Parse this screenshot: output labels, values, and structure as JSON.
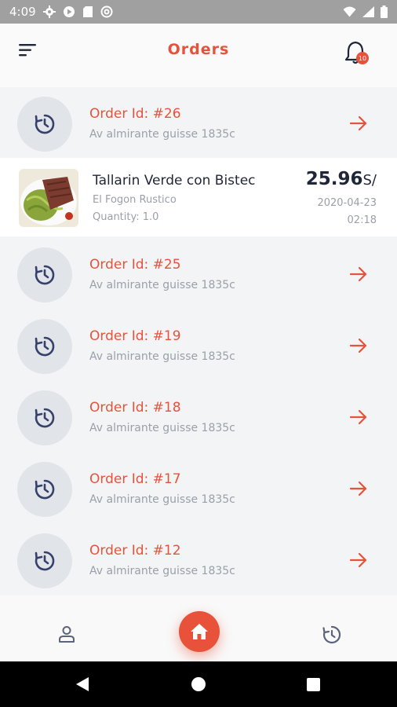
{
  "status_bar": {
    "time": "4:09"
  },
  "header": {
    "title": "Orders",
    "notification_count": "10"
  },
  "orders": [
    {
      "id": "Order Id: #26",
      "address": "Av almirante guisse 1835c"
    },
    {
      "id": "Order Id: #25",
      "address": "Av almirante guisse 1835c"
    },
    {
      "id": "Order Id: #19",
      "address": "Av almirante guisse 1835c"
    },
    {
      "id": "Order Id: #18",
      "address": "Av almirante guisse 1835c"
    },
    {
      "id": "Order Id: #17",
      "address": "Av almirante guisse 1835c"
    },
    {
      "id": "Order Id: #12",
      "address": "Av almirante guisse 1835c"
    }
  ],
  "expanded_item": {
    "name": "Tallarin Verde con Bistec",
    "restaurant": "El Fogon Rustico",
    "quantity": "Quantity: 1.0",
    "price": "25.96",
    "currency": "S/",
    "date": "2020-04-23",
    "time": "02:18"
  },
  "icons": {
    "menu": "sort-menu-icon",
    "bell": "bell-icon",
    "order": "clock-history-icon",
    "arrow": "arrow-right-icon",
    "profile": "person-icon",
    "home": "home-icon",
    "history": "history-icon"
  },
  "colors": {
    "accent": "#e8523a",
    "text_dark": "#1f2637",
    "text_muted": "#9aa0a8",
    "row_bg": "#f3f4f6"
  }
}
